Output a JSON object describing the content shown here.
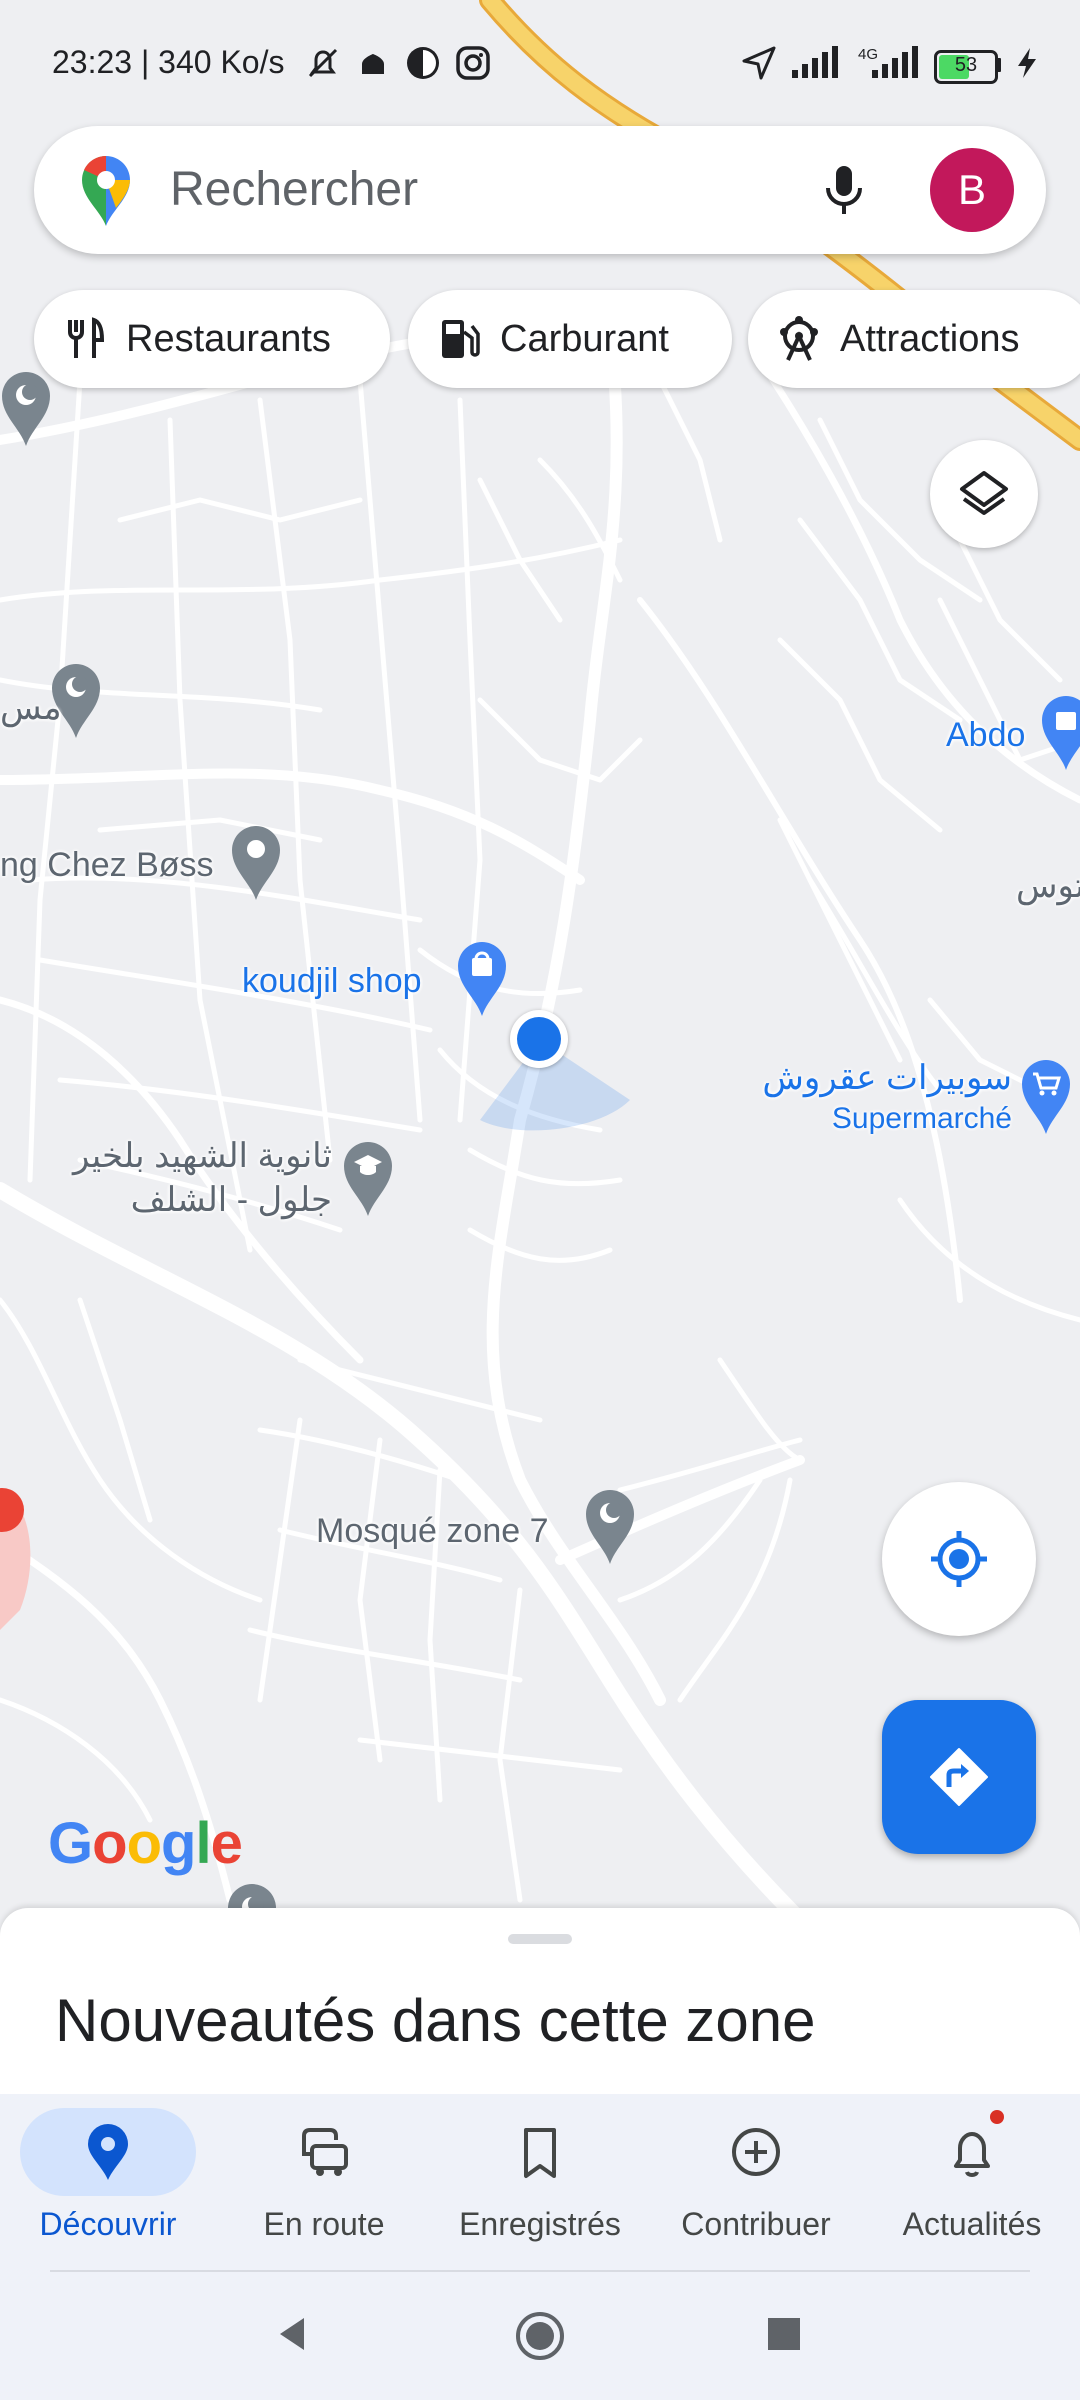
{
  "status_bar": {
    "time_speed": "23:23 | 340 Ko/s",
    "network_label": "4G",
    "battery_level": "53"
  },
  "search": {
    "placeholder": "Rechercher",
    "avatar_letter": "B"
  },
  "chips": [
    {
      "label": "Restaurants",
      "icon": "fork-knife-icon"
    },
    {
      "label": "Carburant",
      "icon": "gas-station-icon"
    },
    {
      "label": "Attractions",
      "icon": "ferris-wheel-icon"
    }
  ],
  "map": {
    "labels": {
      "chez_boss": "ng Chez Bøss",
      "koudjil": "koudjil shop",
      "school_line1": "ثانوية الشهيد بلخير",
      "school_line2": "جلول - الشلف",
      "mosque": "Mosqué zone 7",
      "abdo": "Abdo",
      "supermarket_ar": "سوبيرات عقروش",
      "supermarket_fr": "Supermarché",
      "edge_left": "مس",
      "edge_right": "توس"
    },
    "logo": "Google"
  },
  "sheet": {
    "title": "Nouveautés dans cette zone"
  },
  "bottom_nav": [
    {
      "label": "Découvrir",
      "icon": "pin-icon",
      "active": true
    },
    {
      "label": "En route",
      "icon": "commute-icon",
      "active": false
    },
    {
      "label": "Enregistrés",
      "icon": "bookmark-icon",
      "active": false
    },
    {
      "label": "Contribuer",
      "icon": "add-circle-icon",
      "active": false
    },
    {
      "label": "Actualités",
      "icon": "bell-icon",
      "active": false,
      "badge": true
    }
  ],
  "colors": {
    "accent": "#1a73e8",
    "avatar": "#c2185b",
    "map_background": "#eeeff2",
    "highway": "#f5c242",
    "roads": "#ffffff"
  }
}
